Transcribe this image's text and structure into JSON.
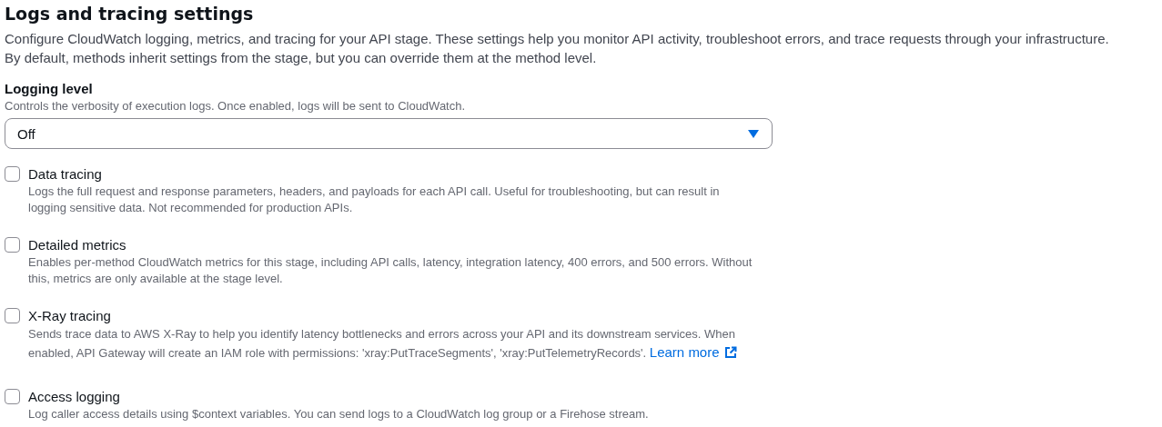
{
  "section": {
    "title": "Logs and tracing settings",
    "description": "Configure CloudWatch logging, metrics, and tracing for your API stage. These settings help you monitor API activity, troubleshoot errors, and trace requests through your infrastructure. By default, methods inherit settings from the stage, but you can override them at the method level."
  },
  "logging_level": {
    "label": "Logging level",
    "hint": "Controls the verbosity of execution logs. Once enabled, logs will be sent to CloudWatch.",
    "value": "Off"
  },
  "options": [
    {
      "label": "Data tracing",
      "checked": false,
      "description": "Logs the full request and response parameters, headers, and payloads for each API call. Useful for troubleshooting, but can result in logging sensitive data. Not recommended for production APIs."
    },
    {
      "label": "Detailed metrics",
      "checked": false,
      "description": "Enables per-method CloudWatch metrics for this stage, including API calls, latency, integration latency, 400 errors, and 500 errors. Without this, metrics are only available at the stage level."
    },
    {
      "label": "X-Ray tracing",
      "checked": false,
      "description": "Sends trace data to AWS X-Ray to help you identify latency bottlenecks and errors across your API and its downstream services. When enabled, API Gateway will create an IAM role with permissions: 'xray:PutTraceSegments', 'xray:PutTelemetryRecords'.",
      "link": "Learn more"
    },
    {
      "label": "Access logging",
      "checked": false,
      "description": "Log caller access details using $context variables. You can send logs to a CloudWatch log group or a Firehose stream."
    }
  ]
}
